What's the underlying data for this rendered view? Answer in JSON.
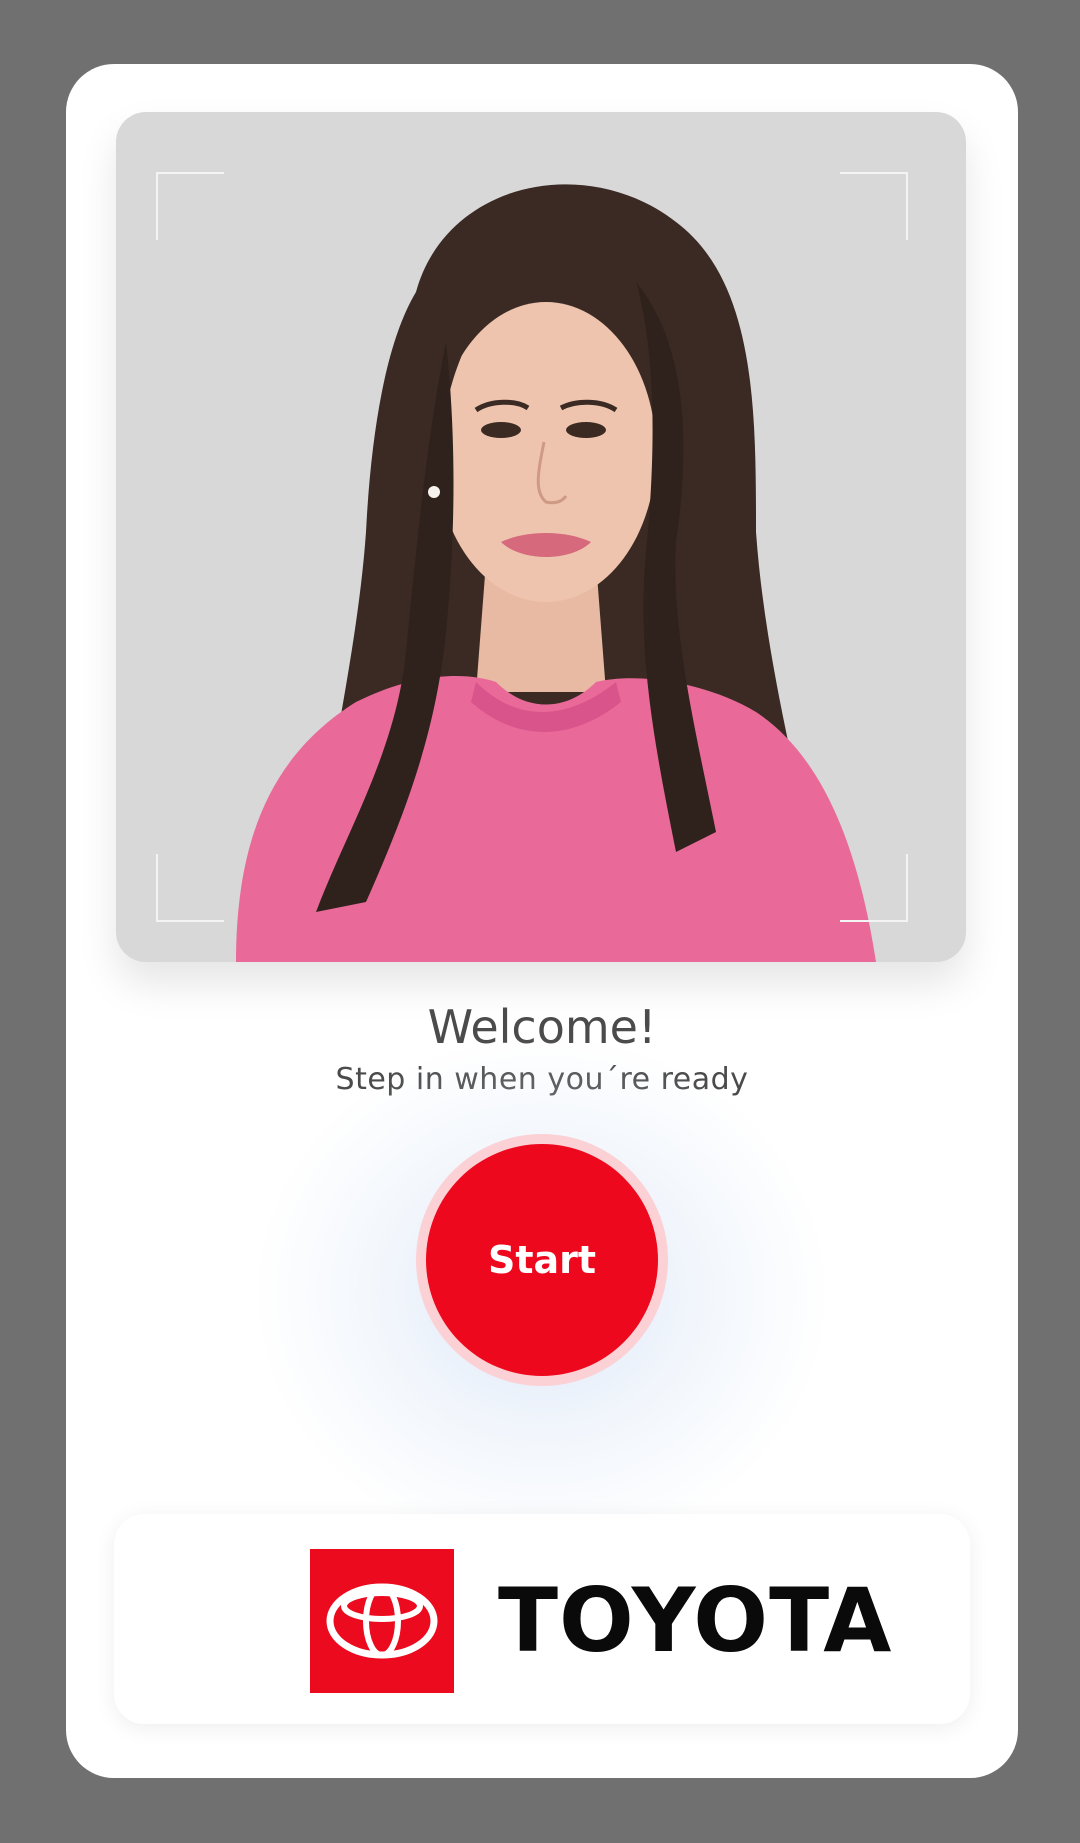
{
  "welcome": {
    "title": "Welcome!",
    "subtitle": "Step in when you´re ready"
  },
  "actions": {
    "start_label": "Start"
  },
  "brand": {
    "name": "TOYOTA",
    "color": "#eb0a1e"
  },
  "colors": {
    "background": "#707070",
    "card": "#ffffff",
    "photo_bg": "#d8d8d8",
    "accent": "#ee081d",
    "accent_ring": "#fcd1d5",
    "text": "#4b4b4b"
  },
  "icons": {
    "brand_logo": "toyota-emblem-icon",
    "viewfinder": "viewfinder-corner-icon"
  }
}
